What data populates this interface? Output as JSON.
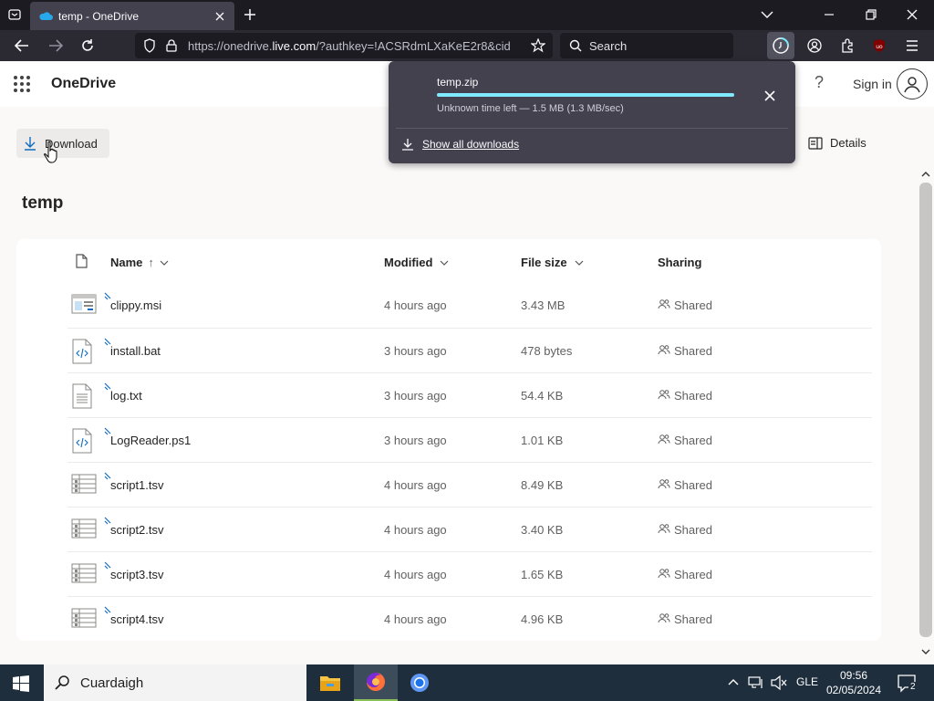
{
  "browser": {
    "tab_title": "temp - OneDrive",
    "url_prefix": "https://onedrive.",
    "url_domain": "live.com",
    "url_suffix": "/?authkey=!ACSRdmLXaKeE2r8&cid",
    "search_placeholder": "Search"
  },
  "downloads_panel": {
    "file_name": "temp.zip",
    "progress_percent": 100,
    "status": "Unknown time left — 1.5 MB (1.3 MB/sec)",
    "show_all": "Show all downloads"
  },
  "onedrive": {
    "app_name": "OneDrive",
    "help_symbol": "?",
    "sign_in": "Sign in",
    "download_label": "Download",
    "details_label": "Details",
    "folder_title": "temp"
  },
  "columns": {
    "name": "Name",
    "modified": "Modified",
    "file_size": "File size",
    "sharing": "Sharing"
  },
  "files": [
    {
      "name": "clippy.msi",
      "modified": "4 hours ago",
      "size": "3.43 MB",
      "sharing": "Shared",
      "icon": "msi-icon"
    },
    {
      "name": "install.bat",
      "modified": "3 hours ago",
      "size": "478 bytes",
      "sharing": "Shared",
      "icon": "code-file-icon"
    },
    {
      "name": "log.txt",
      "modified": "3 hours ago",
      "size": "54.4 KB",
      "sharing": "Shared",
      "icon": "text-file-icon"
    },
    {
      "name": "LogReader.ps1",
      "modified": "3 hours ago",
      "size": "1.01 KB",
      "sharing": "Shared",
      "icon": "code-file-icon"
    },
    {
      "name": "script1.tsv",
      "modified": "4 hours ago",
      "size": "8.49 KB",
      "sharing": "Shared",
      "icon": "spreadsheet-icon"
    },
    {
      "name": "script2.tsv",
      "modified": "4 hours ago",
      "size": "3.40 KB",
      "sharing": "Shared",
      "icon": "spreadsheet-icon"
    },
    {
      "name": "script3.tsv",
      "modified": "4 hours ago",
      "size": "1.65 KB",
      "sharing": "Shared",
      "icon": "spreadsheet-icon"
    },
    {
      "name": "script4.tsv",
      "modified": "4 hours ago",
      "size": "4.96 KB",
      "sharing": "Shared",
      "icon": "spreadsheet-icon"
    }
  ],
  "taskbar": {
    "search_text": "Cuardaigh",
    "language": "GLE",
    "time": "09:56",
    "date": "02/05/2024",
    "notification_count": "2"
  }
}
